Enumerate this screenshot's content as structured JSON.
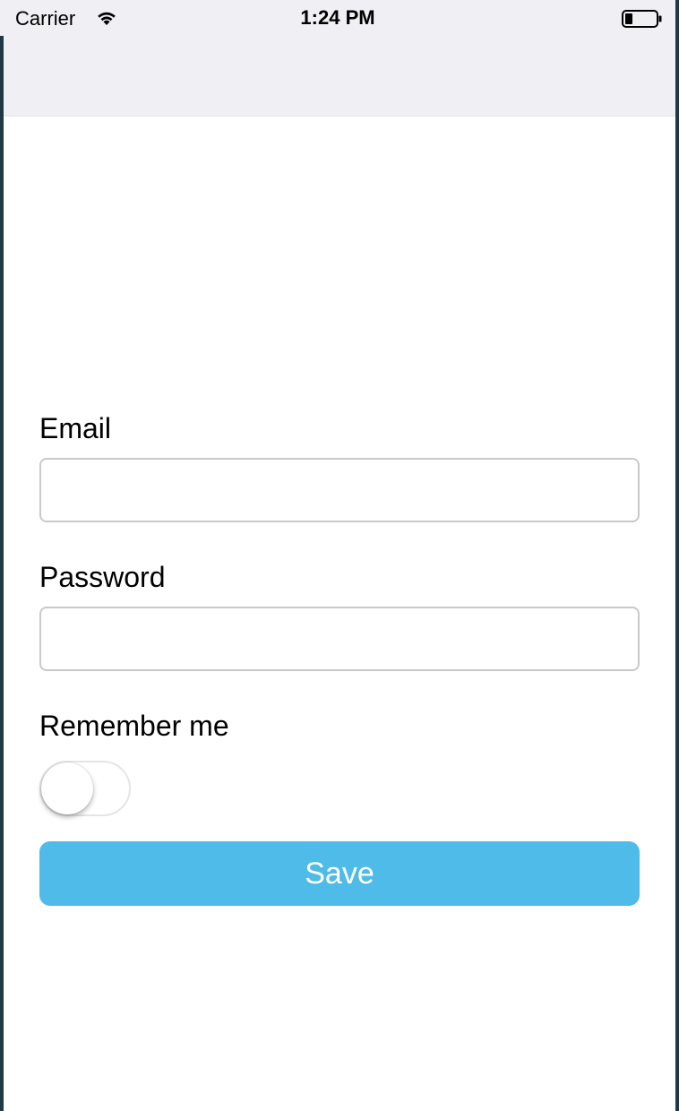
{
  "status_bar": {
    "carrier": "Carrier",
    "time": "1:24 PM",
    "wifi_icon": "wifi-icon",
    "battery_icon": "battery-icon",
    "battery_level": 0.25
  },
  "form": {
    "email": {
      "label": "Email",
      "value": "",
      "placeholder": ""
    },
    "password": {
      "label": "Password",
      "value": "",
      "placeholder": ""
    },
    "remember": {
      "label": "Remember me",
      "checked": false
    },
    "save_label": "Save"
  },
  "colors": {
    "accent": "#4ebbe8",
    "status_bar_bg": "#efeff4",
    "input_border": "#c9c9c9"
  }
}
